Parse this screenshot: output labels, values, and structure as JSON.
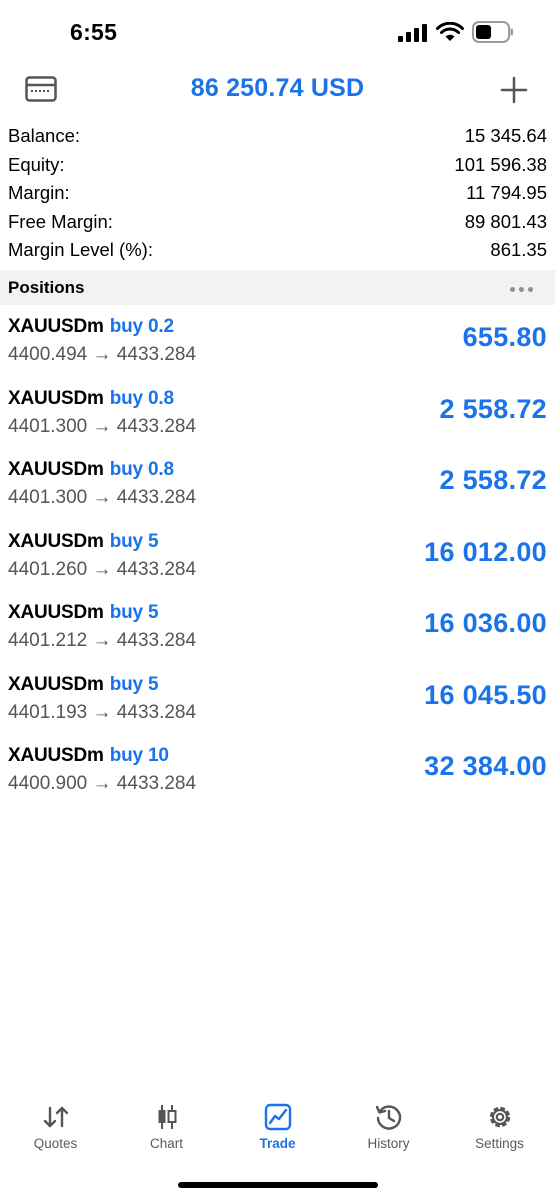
{
  "status_bar": {
    "time": "6:55"
  },
  "header": {
    "title": "86 250.74 USD"
  },
  "summary": [
    {
      "label": "Balance:",
      "value": "15 345.64"
    },
    {
      "label": "Equity:",
      "value": "101 596.38"
    },
    {
      "label": "Margin:",
      "value": "11 794.95"
    },
    {
      "label": "Free Margin:",
      "value": "89 801.43"
    },
    {
      "label": "Margin Level (%):",
      "value": "861.35"
    }
  ],
  "positions_header": {
    "title": "Positions"
  },
  "positions": [
    {
      "symbol": "XAUUSDm",
      "direction": "buy 0.2",
      "prices": "4400.494 → 4433.284",
      "profit": "655.80"
    },
    {
      "symbol": "XAUUSDm",
      "direction": "buy 0.8",
      "prices": "4401.300 → 4433.284",
      "profit": "2 558.72"
    },
    {
      "symbol": "XAUUSDm",
      "direction": "buy 0.8",
      "prices": "4401.300 → 4433.284",
      "profit": "2 558.72"
    },
    {
      "symbol": "XAUUSDm",
      "direction": "buy 5",
      "prices": "4401.260 → 4433.284",
      "profit": "16 012.00"
    },
    {
      "symbol": "XAUUSDm",
      "direction": "buy 5",
      "prices": "4401.212 → 4433.284",
      "profit": "16 036.00"
    },
    {
      "symbol": "XAUUSDm",
      "direction": "buy 5",
      "prices": "4401.193 → 4433.284",
      "profit": "16 045.50"
    },
    {
      "symbol": "XAUUSDm",
      "direction": "buy 10",
      "prices": "4400.900 → 4433.284",
      "profit": "32 384.00"
    }
  ],
  "tabs": [
    {
      "label": "Quotes",
      "icon": "quotes-arrows-icon"
    },
    {
      "label": "Chart",
      "icon": "candlestick-icon"
    },
    {
      "label": "Trade",
      "icon": "trade-chart-icon",
      "active": true
    },
    {
      "label": "History",
      "icon": "history-clock-icon"
    },
    {
      "label": "Settings",
      "icon": "gear-icon"
    }
  ],
  "colors": {
    "accent": "#1a73e8",
    "section_bg": "#f2f2f4",
    "secondary_text": "#555555"
  }
}
